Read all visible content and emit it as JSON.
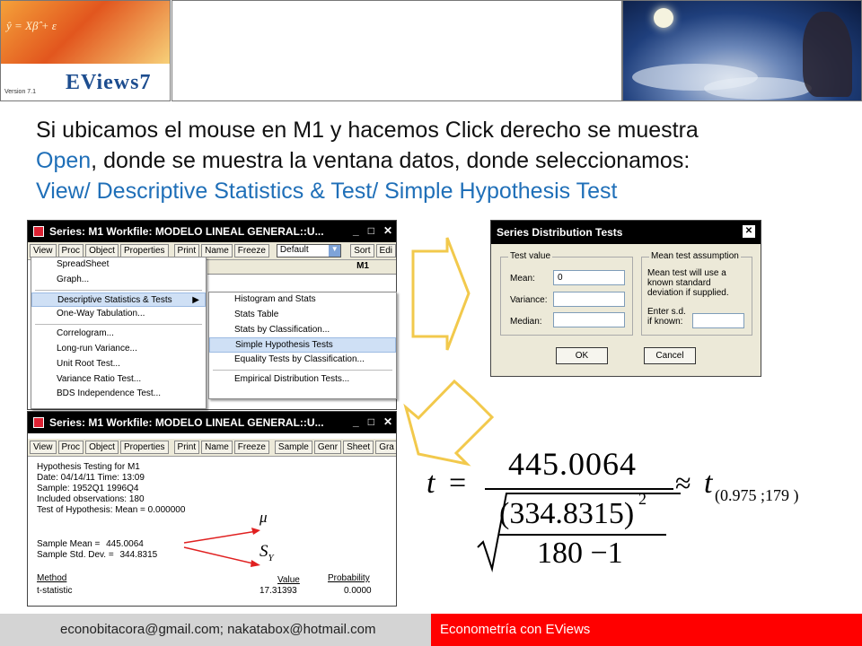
{
  "banner": {
    "logo_formula": "ŷ = Xβ̂ + ε",
    "logo_word": "EViews7",
    "logo_version": "Version 7.1"
  },
  "intro": {
    "line1": "Si ubicamos el mouse en M1 y hacemos Click derecho se muestra",
    "line2_hl": "Open",
    "line2_rest": ", donde se muestra la ventana datos, donde seleccionamos:",
    "line3": "View/ Descriptive Statistics & Test/ Simple Hypothesis Test"
  },
  "window1": {
    "title": "Series: M1    Workfile: MODELO LINEAL GENERAL::U...",
    "toolbar": [
      "View",
      "Proc",
      "Object",
      "Properties",
      "Print",
      "Name",
      "Freeze"
    ],
    "select_value": "Default",
    "toolbar_right": [
      "Sort",
      "Edi"
    ],
    "column_header": "M1",
    "menu": [
      "SpreadSheet",
      "Graph...",
      "Descriptive Statistics & Tests",
      "One-Way Tabulation...",
      "Correlogram...",
      "Long-run Variance...",
      "Unit Root Test...",
      "Variance Ratio Test...",
      "BDS Independence Test..."
    ],
    "submenu": [
      "Histogram and Stats",
      "Stats Table",
      "Stats by Classification...",
      "Simple Hypothesis Tests",
      "Equality Tests by Classification...",
      "Empirical Distribution Tests..."
    ]
  },
  "dialog": {
    "title": "Series Distribution Tests",
    "group1_label": "Test value",
    "mean_label": "Mean:",
    "mean_value": "0",
    "variance_label": "Variance:",
    "median_label": "Median:",
    "group2_label": "Mean test assumption",
    "assumption_text1": "Mean test will use a",
    "assumption_text2": "known standard",
    "assumption_text3": "deviation if supplied.",
    "sd_label1": "Enter s.d.",
    "sd_label2": "if known:",
    "ok": "OK",
    "cancel": "Cancel"
  },
  "window2": {
    "title": "Series: M1    Workfile: MODELO LINEAL GENERAL::U...",
    "toolbar": [
      "View",
      "Proc",
      "Object",
      "Properties",
      "Print",
      "Name",
      "Freeze",
      "Sample",
      "Genr",
      "Sheet",
      "Gra"
    ],
    "lines": [
      "Hypothesis Testing for M1",
      "Date: 04/14/11   Time: 13:09",
      "Sample: 1952Q1 1996Q4",
      "Included observations: 180",
      "Test of Hypothesis: Mean =  0.000000"
    ],
    "sample_mean_label": "Sample Mean =",
    "sample_mean": "445.0064",
    "sample_sd_label": "Sample Std. Dev. =",
    "sample_sd": "344.8315",
    "mu_symbol": "μ",
    "sy_symbol": "S",
    "sy_sub": "Y",
    "col_method": "Method",
    "col_value": "Value",
    "col_prob": "Probability",
    "row_method": "t-statistic",
    "row_value": "17.31393",
    "row_prob": "0.0000"
  },
  "formula": {
    "t": "t",
    "eq": "=",
    "numerator": "445.0064",
    "denom_inner": "(334.8315)",
    "exponent": "2",
    "denom_bottom": "180 −1",
    "approx": "≈",
    "t_rhs": "t",
    "subscript": "(0.975 ;179 )"
  },
  "footer": {
    "emails": "econobitacora@gmail.com;  nakatabox@hotmail.com",
    "course": "Econometría con EViews"
  }
}
